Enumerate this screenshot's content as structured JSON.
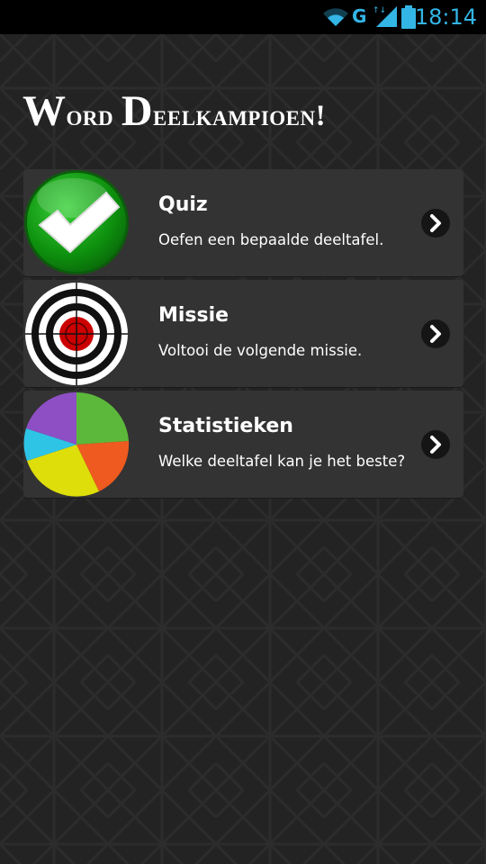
{
  "status_bar": {
    "network": "G",
    "time": "18:14",
    "icons": [
      "wifi-icon",
      "signal-icon",
      "battery-icon"
    ],
    "accent_color": "#33b5e5"
  },
  "title": {
    "first_letter_1": "W",
    "rest_1": "ord",
    "first_letter_2": "D",
    "rest_2": "eelkampioen!"
  },
  "menu": [
    {
      "title": "Quiz",
      "subtitle": "Oefen een bepaalde deeltafel.",
      "icon": "checkmark-icon"
    },
    {
      "title": "Missie",
      "subtitle": "Voltooi de volgende missie.",
      "icon": "target-icon"
    },
    {
      "title": "Statistieken",
      "subtitle": "Welke deeltafel kan je het beste?",
      "icon": "pie-chart-icon"
    }
  ],
  "colors": {
    "background": "#232323",
    "card": "#333333",
    "text": "#ffffff"
  }
}
